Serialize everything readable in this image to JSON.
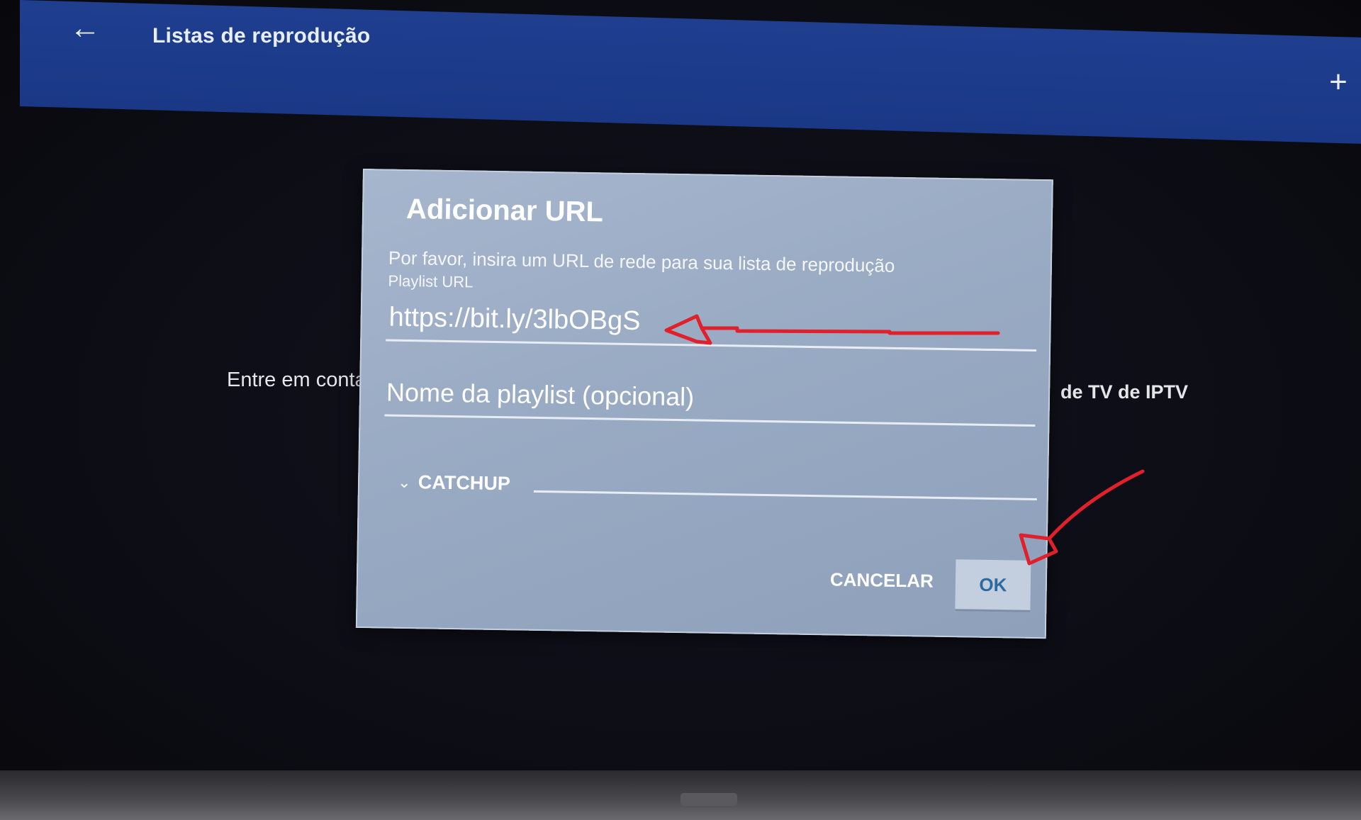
{
  "app_bar": {
    "back_icon": "arrow-left-icon",
    "title": "Listas de reprodução",
    "add_icon": "plus-icon"
  },
  "background": {
    "left_text": "Entre em conta",
    "right_text": "de TV de IPTV"
  },
  "dialog": {
    "title": "Adicionar URL",
    "message": "Por favor, insira um URL de rede para sua lista de reprodução",
    "url_caption": "Playlist URL",
    "url_value": "https://bit.ly/3lbOBgS",
    "name_placeholder": "Nome da playlist (opcional)",
    "catchup_label": "CATCHUP",
    "catchup_icon": "chevron-down-icon",
    "cancel_label": "CANCELAR",
    "ok_label": "OK"
  },
  "colors": {
    "app_bar": "#1f3e8f",
    "dialog": "#9aabc4",
    "annotation": "#e0202a",
    "ok_text": "#2d6aa0"
  }
}
